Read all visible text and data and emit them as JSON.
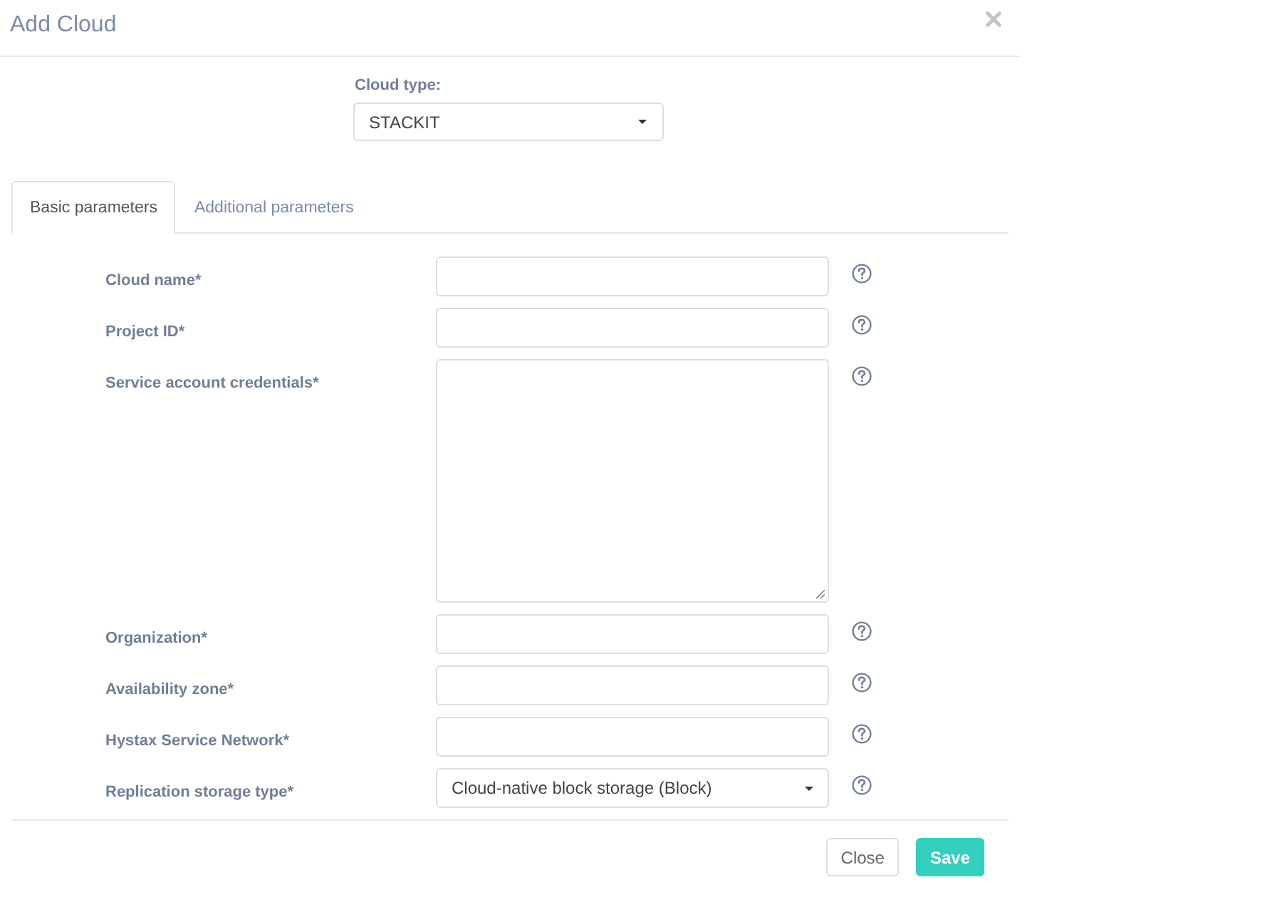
{
  "dialog": {
    "title": "Add Cloud"
  },
  "cloud_type": {
    "label": "Cloud type:",
    "value": "STACKIT"
  },
  "tabs": [
    {
      "label": "Basic parameters",
      "selected": true
    },
    {
      "label": "Additional parameters",
      "selected": false
    }
  ],
  "fields": [
    {
      "label": "Cloud name*",
      "kind": "text"
    },
    {
      "label": "Project ID*",
      "kind": "text"
    },
    {
      "label": "Service account credentials*",
      "kind": "textarea"
    },
    {
      "label": "Organization*",
      "kind": "text"
    },
    {
      "label": "Availability zone*",
      "kind": "text"
    },
    {
      "label": "Hystax Service Network*",
      "kind": "text"
    },
    {
      "label": "Replication storage type*",
      "kind": "select",
      "value": "Cloud-native block storage (Block)"
    }
  ],
  "buttons": [
    {
      "label": "Close",
      "kind": "secondary"
    },
    {
      "label": "Save",
      "kind": "primary"
    }
  ]
}
